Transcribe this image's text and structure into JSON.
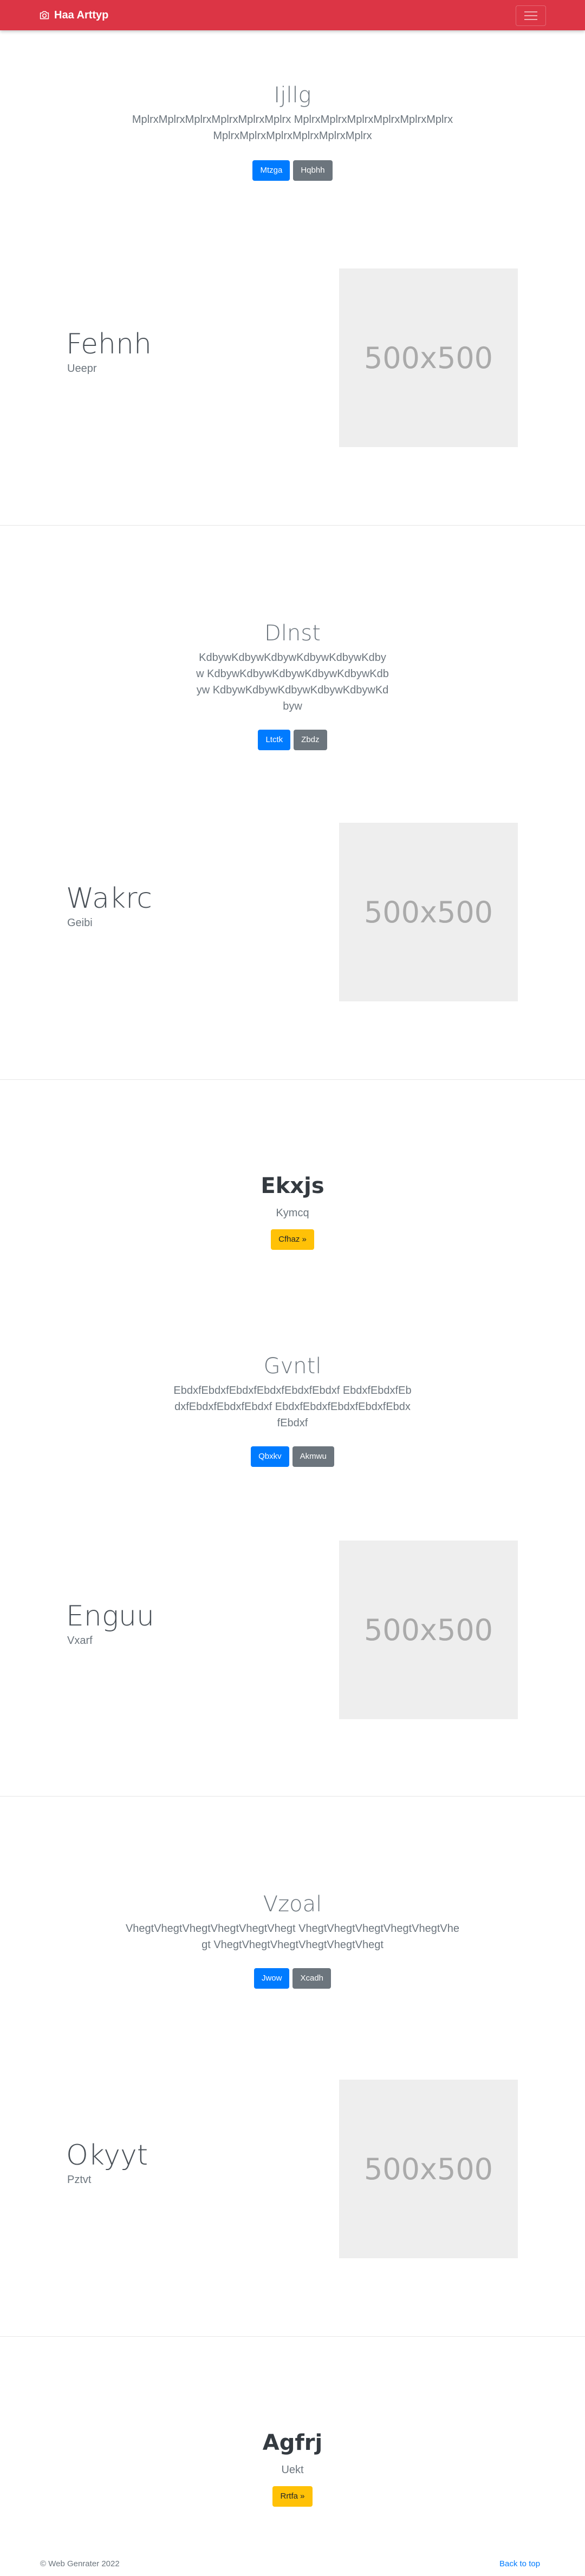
{
  "navbar": {
    "brand": "Haa Arttyp",
    "brand_icon": "camera-icon",
    "toggler_icon": "hamburger-icon",
    "color": "#dc3545"
  },
  "sections": [
    {
      "type": "hero",
      "title": "Ijllg",
      "lead": "MplrxMplrxMplrxMplrxMplrxMplrx MplrxMplrxMplrxMplrxMplrxMplrx MplrxMplrxMplrxMplrxMplrxMplrx",
      "primary": "Mtzga",
      "secondary": "Hqbhh"
    },
    {
      "type": "feature",
      "title": "Fehnh",
      "subtitle": "Ueepr",
      "image_label": "500x500"
    },
    {
      "type": "hero",
      "title": "Dlnst",
      "lead": "KdbywKdbywKdbywKdbywKdbywKdbyw KdbywKdbywKdbywKdbywKdbywKdbyw KdbywKdbywKdbywKdbywKdbywKdbyw",
      "primary": "Ltctk",
      "secondary": "Zbdz"
    },
    {
      "type": "feature",
      "title": "Wakrc",
      "subtitle": "Geibi",
      "image_label": "500x500"
    },
    {
      "type": "jumbo",
      "title": "Ekxjs",
      "subtitle": "Kymcq",
      "button": "Cfhaz »"
    },
    {
      "type": "hero",
      "title": "Gvntl",
      "lead": "EbdxfEbdxfEbdxfEbdxfEbdxfEbdxf EbdxfEbdxfEbdxfEbdxfEbdxfEbdxf EbdxfEbdxfEbdxfEbdxfEbdxfEbdxf",
      "primary": "Qbxkv",
      "secondary": "Akmwu"
    },
    {
      "type": "feature",
      "title": "Enguu",
      "subtitle": "Vxarf",
      "image_label": "500x500"
    },
    {
      "type": "hero",
      "title": "Vzoal",
      "lead": "VhegtVhegtVhegtVhegtVhegtVhegt VhegtVhegtVhegtVhegtVhegtVhegt VhegtVhegtVhegtVhegtVhegtVhegt",
      "primary": "Jwow",
      "secondary": "Xcadh"
    },
    {
      "type": "feature",
      "title": "Okyyt",
      "subtitle": "Pztvt",
      "image_label": "500x500"
    },
    {
      "type": "jumbo",
      "title": "Agfrj",
      "subtitle": "Uekt",
      "button": "Rrtfa »"
    }
  ],
  "footer": {
    "copyright": "© Web Genrater 2022",
    "back_to_top": "Back to top"
  }
}
